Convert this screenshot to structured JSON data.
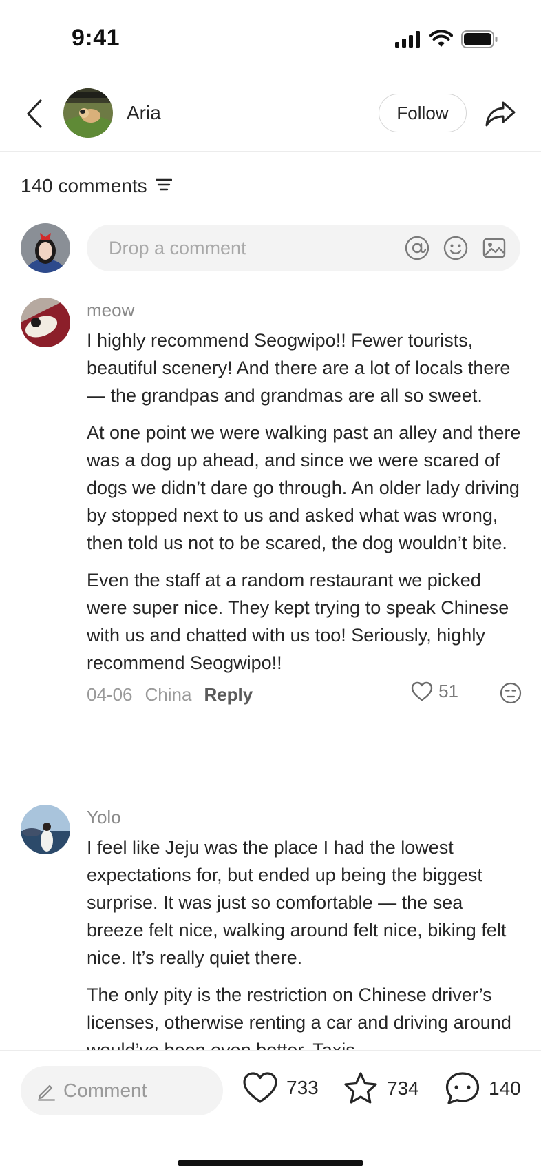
{
  "status_bar": {
    "time": "9:41"
  },
  "header": {
    "author_name": "Aria",
    "follow_label": "Follow"
  },
  "comments_header": {
    "count_label": "140 comments"
  },
  "comment_input": {
    "placeholder": "Drop a comment"
  },
  "comments": [
    {
      "username": "meow",
      "paragraphs": [
        "I highly recommend Seogwipo!! Fewer tourists, beautiful scenery! And there are a lot of locals there — the grandpas and grandmas are all so sweet.",
        "At one point we were walking past an alley and there was a dog up ahead, and since we were scared of dogs we didn’t dare go through. An older lady driving by stopped next to us and asked what was wrong, then told us not to be scared, the dog wouldn’t bite.",
        "Even the staff at a random restaurant we picked were super nice. They kept trying to speak Chinese with us and chatted with us too! Seriously, highly recommend Seogwipo!!"
      ],
      "date": "04-06",
      "location": "China",
      "reply_label": "Reply",
      "likes": "51"
    },
    {
      "username": "Yolo",
      "paragraphs": [
        "I feel like Jeju was the place I had the lowest expectations for, but ended up being the biggest surprise. It was just so comfortable — the sea breeze felt nice, walking around felt nice, biking felt nice. It’s really quiet there.",
        "The only pity is the restriction on Chinese driver’s licenses, otherwise renting a car and driving around would’ve been even better. Taxis"
      ]
    }
  ],
  "bottom_bar": {
    "comment_label": "Comment",
    "likes": "733",
    "favorites": "734",
    "comments": "140"
  }
}
